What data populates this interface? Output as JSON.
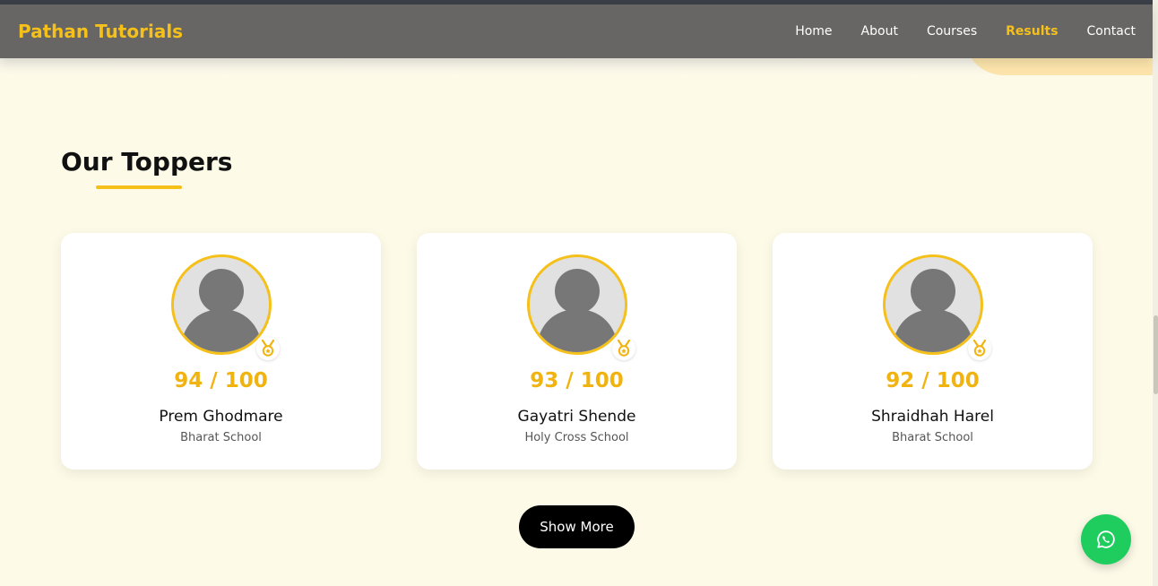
{
  "header": {
    "brand": "Pathan Tutorials",
    "nav": [
      "Home",
      "About",
      "Courses",
      "Results",
      "Contact"
    ],
    "active": "Results"
  },
  "section": {
    "title": "Our Toppers"
  },
  "toppers": [
    {
      "score": "94 / 100",
      "name": "Prem Ghodmare",
      "school": "Bharat School"
    },
    {
      "score": "93 / 100",
      "name": "Gayatri Shende",
      "school": "Holy Cross School"
    },
    {
      "score": "92 / 100",
      "name": "Shraidhah Harel",
      "school": "Bharat School"
    }
  ],
  "show_more_label": "Show More",
  "icons": {
    "avatar": "user-avatar-icon",
    "medal": "medal-icon",
    "whatsapp": "whatsapp-icon"
  },
  "colors": {
    "accent": "#f5c01a",
    "header_bg": "#676664",
    "page_bg": "#fdfae8",
    "whatsapp": "#1fcd5f"
  }
}
